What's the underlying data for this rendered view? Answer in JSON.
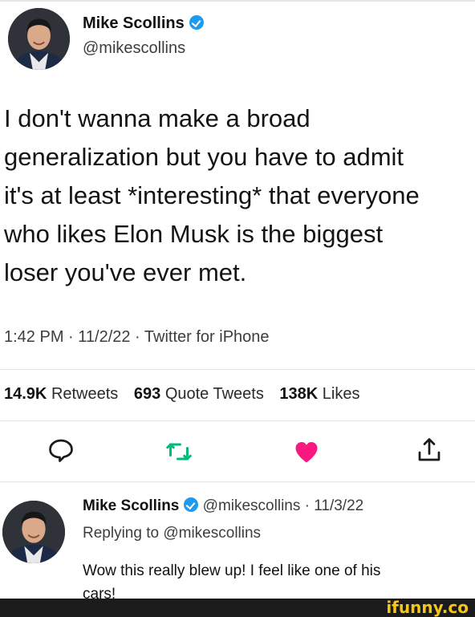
{
  "tweet": {
    "author_name": "Mike Scollins",
    "handle": "@mikescollins",
    "verified": true,
    "text_lines": [
      "I don't wanna make a broad",
      "generalization but you have to admit",
      "it's at least *interesting* that everyone",
      "who likes Elon Musk is the biggest",
      "loser you've ever met."
    ],
    "meta": "1:42 PM · 11/2/22 · Twitter for iPhone",
    "stats": {
      "retweets_count": "14.9K",
      "retweets_label": "Retweets",
      "quotes_count": "693",
      "quotes_label": "Quote Tweets",
      "likes_count": "138K",
      "likes_label": "Likes"
    },
    "actions": {
      "reply_icon": "speech-bubble-icon",
      "retweet_icon": "retweet-icon",
      "like_icon": "heart-icon",
      "share_icon": "share-icon",
      "like_color": "#f91880",
      "retweet_color": "#00ba7c"
    }
  },
  "reply": {
    "author_name": "Mike Scollins",
    "handle_date": "@mikescollins · 11/3/22",
    "replying_prefix": "Replying to",
    "replying_to": "@mikescollins",
    "text_lines": [
      "Wow this really blew up! I feel like one of his",
      "cars!"
    ]
  },
  "watermark": "ifunny.co"
}
